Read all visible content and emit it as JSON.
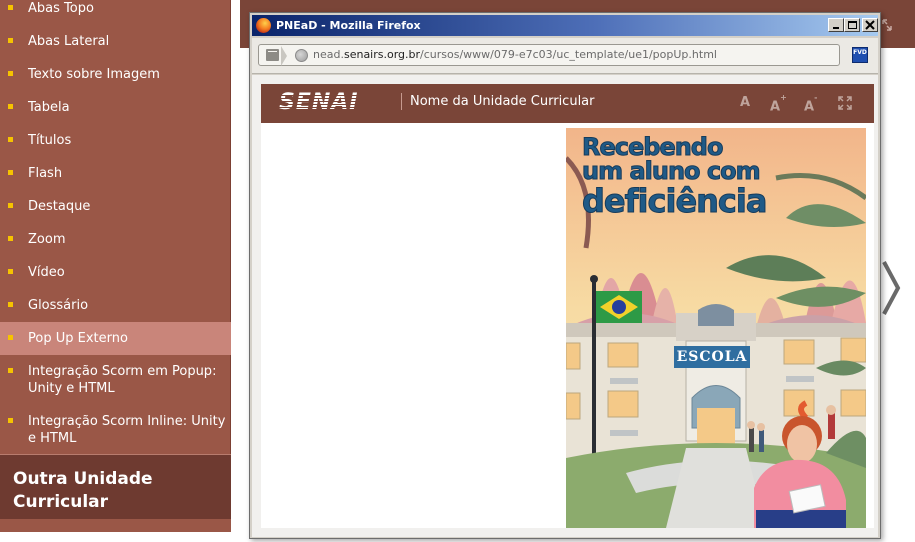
{
  "sidebar": {
    "items": [
      {
        "label": "Abas Topo",
        "active": false
      },
      {
        "label": "Abas Lateral",
        "active": false
      },
      {
        "label": "Texto sobre Imagem",
        "active": false
      },
      {
        "label": "Tabela",
        "active": false
      },
      {
        "label": "Títulos",
        "active": false
      },
      {
        "label": "Flash",
        "active": false
      },
      {
        "label": "Destaque",
        "active": false
      },
      {
        "label": "Zoom",
        "active": false
      },
      {
        "label": "Vídeo",
        "active": false
      },
      {
        "label": "Glossário",
        "active": false
      },
      {
        "label": "Pop Up Externo",
        "active": true
      },
      {
        "label": "Integração Scorm em Popup: Unity e HTML",
        "active": false
      },
      {
        "label": "Integração Scorm Inline: Unity e HTML",
        "active": false
      }
    ],
    "other_unit_label": "Outra Unidade Curricular"
  },
  "popup": {
    "window_title": "PNEaD - Mozilla Firefox",
    "url_prefix": "nead.",
    "url_domain": "senairs.org.br",
    "url_path": "/cursos/www/079-e7c03/uc_template/ue1/popUp.html",
    "fvd_label": "FVD",
    "header": {
      "logo_text": "SENAI",
      "unit_name": "Nome da Unidade Curricular",
      "tool_a": "A",
      "tool_a_plus": "A",
      "tool_a_plus_sup": "+",
      "tool_a_minus": "A",
      "tool_a_minus_sup": "-"
    },
    "cover": {
      "title_line1": "Recebendo",
      "title_line2": "um aluno com",
      "title_line3": "deficiência",
      "school_label": "ESCOLA"
    }
  },
  "colors": {
    "sidebar_bg": "#9a5747",
    "sidebar_active": "#c9857a",
    "bullet": "#f6c300",
    "header_bg": "#7a4538",
    "other_unit_bg": "#6e3a30"
  },
  "icons": {
    "window_app": "firefox-icon",
    "url_page": "page-icon",
    "url_site": "globe-icon",
    "next": "chevron-right-icon",
    "expand": "expand-icon"
  }
}
